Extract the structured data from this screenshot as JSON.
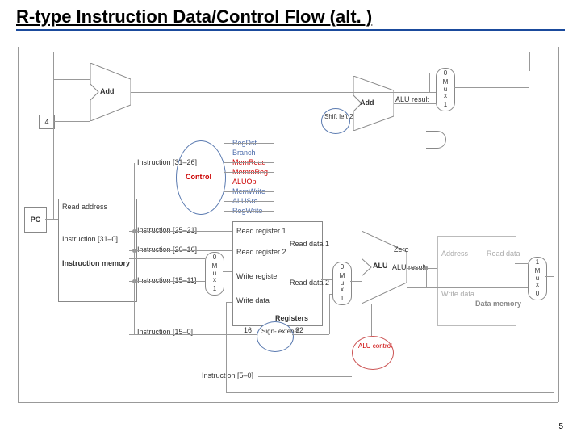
{
  "slide": {
    "title": "R-type Instruction Data/Control Flow (alt. )",
    "page_number": "5"
  },
  "blocks": {
    "pc": "PC",
    "add_top": "Add",
    "four": "4",
    "imem_read_addr": "Read\naddress",
    "imem_full": "Instruction\n[31–0]",
    "imem_title": "Instruction\nmemory",
    "control": "Control",
    "reg_title": "Registers",
    "read_reg1": "Read\nregister 1",
    "read_reg2": "Read\nregister 2",
    "write_reg": "Write\nregister",
    "write_data": "Write\ndata",
    "read_data1": "Read\ndata 1",
    "read_data2": "Read\ndata 2",
    "alu": "ALU",
    "alu_result": "ALU\nresult",
    "zero": "Zero",
    "add_mid": "Add",
    "add_mid_res": "ALU\nresult",
    "shift": "Shift\nleft 2",
    "sign_extend": "Sign-\nextend",
    "alu_control": "ALU\ncontrol",
    "dmem_addr": "Address",
    "dmem_read": "Read\ndata",
    "dmem_write": "Write\ndata",
    "dmem_title": "Data\nmemory"
  },
  "mux": {
    "top": {
      "t": "0",
      "m": "M\nu\nx",
      "b": "1"
    },
    "rdst": {
      "t": "0",
      "m": "M\nu\nx",
      "b": "1"
    },
    "alusrc": {
      "t": "0",
      "m": "M\nu\nx",
      "b": "1"
    },
    "wb": {
      "t": "1",
      "m": "M\nu\nx",
      "b": "0"
    }
  },
  "fields": {
    "i31_26": "Instruction [31–26]",
    "i25_21": "Instruction [25–21]",
    "i20_16": "Instruction [20–16]",
    "i15_11": "Instruction [15–11]",
    "i15_0": "Instruction [15–0]",
    "i5_0": "Instruction [5–0]",
    "se_in": "16",
    "se_out": "32"
  },
  "signals": {
    "reg_dst": "RegDst",
    "branch": "Branch",
    "mem_read": "MemRead",
    "memtoreg": "MemtoReg",
    "aluop": "ALUOp",
    "mem_write": "MemWrite",
    "alusrc": "ALUSrc",
    "reg_write": "RegWrite"
  }
}
